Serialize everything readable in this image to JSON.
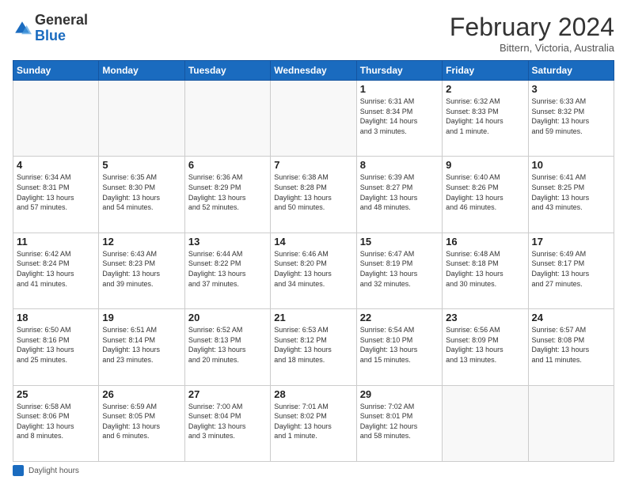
{
  "header": {
    "logo_general": "General",
    "logo_blue": "Blue",
    "month_title": "February 2024",
    "location": "Bittern, Victoria, Australia"
  },
  "calendar": {
    "days_of_week": [
      "Sunday",
      "Monday",
      "Tuesday",
      "Wednesday",
      "Thursday",
      "Friday",
      "Saturday"
    ],
    "weeks": [
      [
        {
          "day": "",
          "info": ""
        },
        {
          "day": "",
          "info": ""
        },
        {
          "day": "",
          "info": ""
        },
        {
          "day": "",
          "info": ""
        },
        {
          "day": "1",
          "info": "Sunrise: 6:31 AM\nSunset: 8:34 PM\nDaylight: 14 hours\nand 3 minutes."
        },
        {
          "day": "2",
          "info": "Sunrise: 6:32 AM\nSunset: 8:33 PM\nDaylight: 14 hours\nand 1 minute."
        },
        {
          "day": "3",
          "info": "Sunrise: 6:33 AM\nSunset: 8:32 PM\nDaylight: 13 hours\nand 59 minutes."
        }
      ],
      [
        {
          "day": "4",
          "info": "Sunrise: 6:34 AM\nSunset: 8:31 PM\nDaylight: 13 hours\nand 57 minutes."
        },
        {
          "day": "5",
          "info": "Sunrise: 6:35 AM\nSunset: 8:30 PM\nDaylight: 13 hours\nand 54 minutes."
        },
        {
          "day": "6",
          "info": "Sunrise: 6:36 AM\nSunset: 8:29 PM\nDaylight: 13 hours\nand 52 minutes."
        },
        {
          "day": "7",
          "info": "Sunrise: 6:38 AM\nSunset: 8:28 PM\nDaylight: 13 hours\nand 50 minutes."
        },
        {
          "day": "8",
          "info": "Sunrise: 6:39 AM\nSunset: 8:27 PM\nDaylight: 13 hours\nand 48 minutes."
        },
        {
          "day": "9",
          "info": "Sunrise: 6:40 AM\nSunset: 8:26 PM\nDaylight: 13 hours\nand 46 minutes."
        },
        {
          "day": "10",
          "info": "Sunrise: 6:41 AM\nSunset: 8:25 PM\nDaylight: 13 hours\nand 43 minutes."
        }
      ],
      [
        {
          "day": "11",
          "info": "Sunrise: 6:42 AM\nSunset: 8:24 PM\nDaylight: 13 hours\nand 41 minutes."
        },
        {
          "day": "12",
          "info": "Sunrise: 6:43 AM\nSunset: 8:23 PM\nDaylight: 13 hours\nand 39 minutes."
        },
        {
          "day": "13",
          "info": "Sunrise: 6:44 AM\nSunset: 8:22 PM\nDaylight: 13 hours\nand 37 minutes."
        },
        {
          "day": "14",
          "info": "Sunrise: 6:46 AM\nSunset: 8:20 PM\nDaylight: 13 hours\nand 34 minutes."
        },
        {
          "day": "15",
          "info": "Sunrise: 6:47 AM\nSunset: 8:19 PM\nDaylight: 13 hours\nand 32 minutes."
        },
        {
          "day": "16",
          "info": "Sunrise: 6:48 AM\nSunset: 8:18 PM\nDaylight: 13 hours\nand 30 minutes."
        },
        {
          "day": "17",
          "info": "Sunrise: 6:49 AM\nSunset: 8:17 PM\nDaylight: 13 hours\nand 27 minutes."
        }
      ],
      [
        {
          "day": "18",
          "info": "Sunrise: 6:50 AM\nSunset: 8:16 PM\nDaylight: 13 hours\nand 25 minutes."
        },
        {
          "day": "19",
          "info": "Sunrise: 6:51 AM\nSunset: 8:14 PM\nDaylight: 13 hours\nand 23 minutes."
        },
        {
          "day": "20",
          "info": "Sunrise: 6:52 AM\nSunset: 8:13 PM\nDaylight: 13 hours\nand 20 minutes."
        },
        {
          "day": "21",
          "info": "Sunrise: 6:53 AM\nSunset: 8:12 PM\nDaylight: 13 hours\nand 18 minutes."
        },
        {
          "day": "22",
          "info": "Sunrise: 6:54 AM\nSunset: 8:10 PM\nDaylight: 13 hours\nand 15 minutes."
        },
        {
          "day": "23",
          "info": "Sunrise: 6:56 AM\nSunset: 8:09 PM\nDaylight: 13 hours\nand 13 minutes."
        },
        {
          "day": "24",
          "info": "Sunrise: 6:57 AM\nSunset: 8:08 PM\nDaylight: 13 hours\nand 11 minutes."
        }
      ],
      [
        {
          "day": "25",
          "info": "Sunrise: 6:58 AM\nSunset: 8:06 PM\nDaylight: 13 hours\nand 8 minutes."
        },
        {
          "day": "26",
          "info": "Sunrise: 6:59 AM\nSunset: 8:05 PM\nDaylight: 13 hours\nand 6 minutes."
        },
        {
          "day": "27",
          "info": "Sunrise: 7:00 AM\nSunset: 8:04 PM\nDaylight: 13 hours\nand 3 minutes."
        },
        {
          "day": "28",
          "info": "Sunrise: 7:01 AM\nSunset: 8:02 PM\nDaylight: 13 hours\nand 1 minute."
        },
        {
          "day": "29",
          "info": "Sunrise: 7:02 AM\nSunset: 8:01 PM\nDaylight: 12 hours\nand 58 minutes."
        },
        {
          "day": "",
          "info": ""
        },
        {
          "day": "",
          "info": ""
        }
      ]
    ]
  },
  "footer": {
    "legend_label": "Daylight hours"
  }
}
